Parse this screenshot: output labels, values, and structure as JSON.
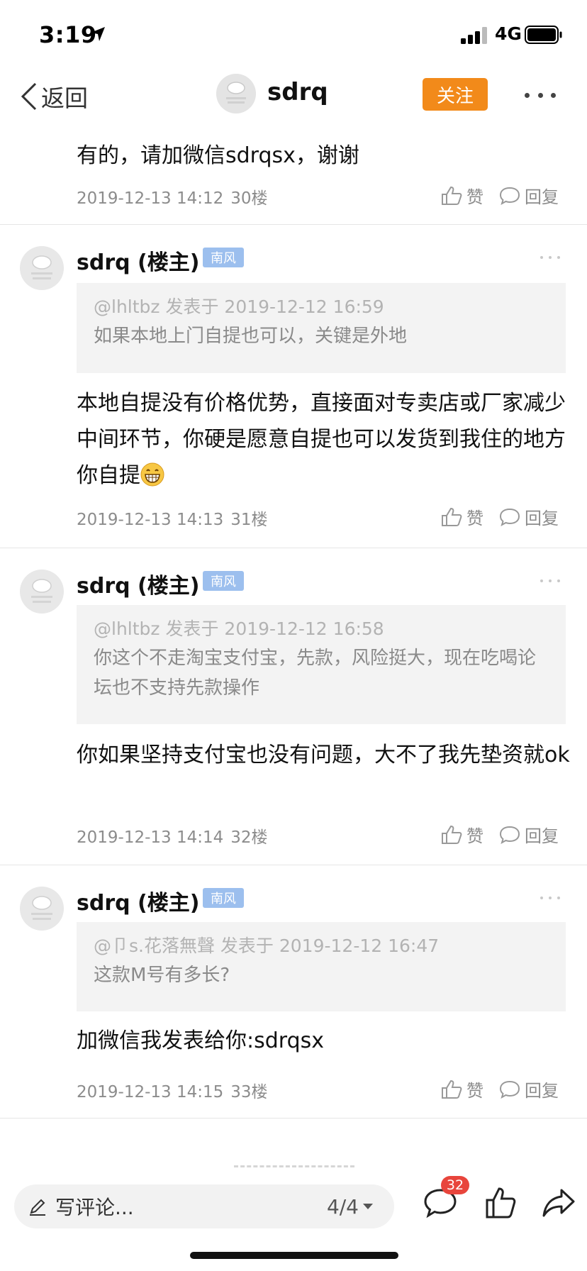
{
  "status_bar": {
    "time": "3:19",
    "network": "4G"
  },
  "nav": {
    "back_label": "返回",
    "title": "sdrq",
    "follow_label": "关注"
  },
  "first_post": {
    "content": "有的，请加微信sdrqsx，谢谢",
    "timestamp": "2019-12-13 14:12",
    "floor": "30楼",
    "like_label": "赞",
    "reply_label": "回复"
  },
  "posts": [
    {
      "author": "sdrq (楼主)",
      "badge": "南风",
      "quote_head": "@lhltbz 发表于 2019-12-12 16:59",
      "quote_text": "如果本地上门自提也可以，关键是外地",
      "content": "本地自提没有价格优势，直接面对专卖店或厂家减少中间环节，你硬是愿意自提也可以发货到我住的地方你自提",
      "timestamp": "2019-12-13 14:13",
      "floor": "31楼",
      "like_label": "赞",
      "reply_label": "回复"
    },
    {
      "author": "sdrq (楼主)",
      "badge": "南风",
      "quote_head": "@lhltbz 发表于 2019-12-12 16:58",
      "quote_text": "你这个不走淘宝支付宝，先款，风险挺大，现在吃喝论坛也不支持先款操作",
      "content": "你如果坚持支付宝也没有问题，大不了我先垫资就ok",
      "timestamp": "2019-12-13 14:14",
      "floor": "32楼",
      "like_label": "赞",
      "reply_label": "回复"
    },
    {
      "author": "sdrq (楼主)",
      "badge": "南风",
      "quote_head": "@卩s.花落無聲 发表于 2019-12-12 16:47",
      "quote_text": "这款M号有多长?",
      "content": "加微信我发表给你:sdrqsx",
      "timestamp": "2019-12-13 14:15",
      "floor": "33楼",
      "like_label": "赞",
      "reply_label": "回复"
    }
  ],
  "bottom_bar": {
    "comment_placeholder": "写评论...",
    "page_indicator": "4/4",
    "comment_count": "32"
  },
  "colors": {
    "follow_button": "#f28a1a",
    "badge": "#9cbfee",
    "count_badge": "#e8453c"
  },
  "icons": [
    "location-arrow-icon",
    "signal-icon",
    "battery-icon",
    "back-chevron-icon",
    "more-icon",
    "thumbs-up-icon",
    "speech-bubble-icon",
    "pencil-icon",
    "share-arrow-icon",
    "grin-emoji-icon"
  ]
}
